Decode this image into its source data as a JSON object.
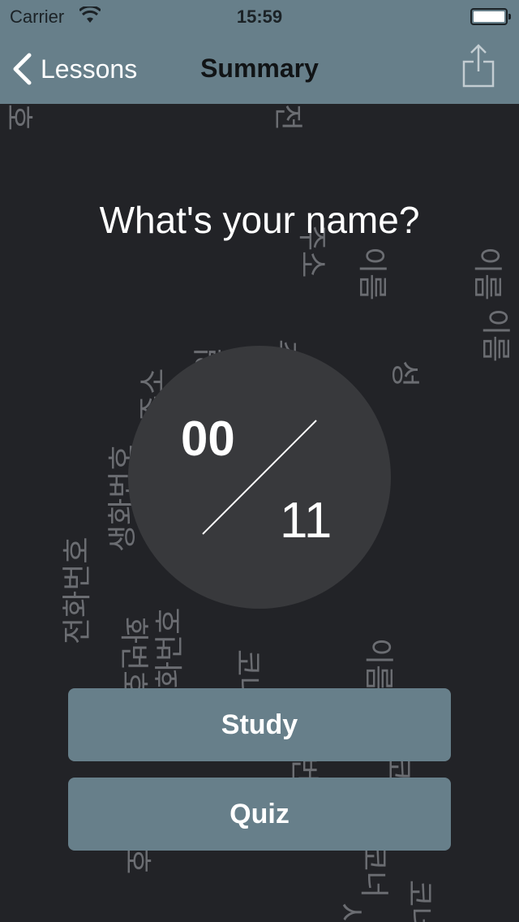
{
  "status_bar": {
    "carrier": "Carrier",
    "time": "15:59"
  },
  "nav": {
    "back_label": "Lessons",
    "title": "Summary",
    "share_icon": "share-icon"
  },
  "question": "What's your name?",
  "score": {
    "correct": "00",
    "total": "11"
  },
  "buttons": {
    "study": "Study",
    "quiz": "Quiz"
  },
  "background_words": [
    "호",
    "전",
    "주소",
    "이름",
    "이름",
    "이름",
    "주",
    "성",
    "주소",
    "생년월일",
    "생화번호",
    "길",
    "전화번호",
    "화번호",
    "화번호",
    "코너",
    "이름",
    "번",
    "코너",
    "호",
    "코너",
    "코너",
    "시"
  ],
  "colors": {
    "background": "#222327",
    "accent": "#677f8a",
    "circle": "#38393c"
  }
}
